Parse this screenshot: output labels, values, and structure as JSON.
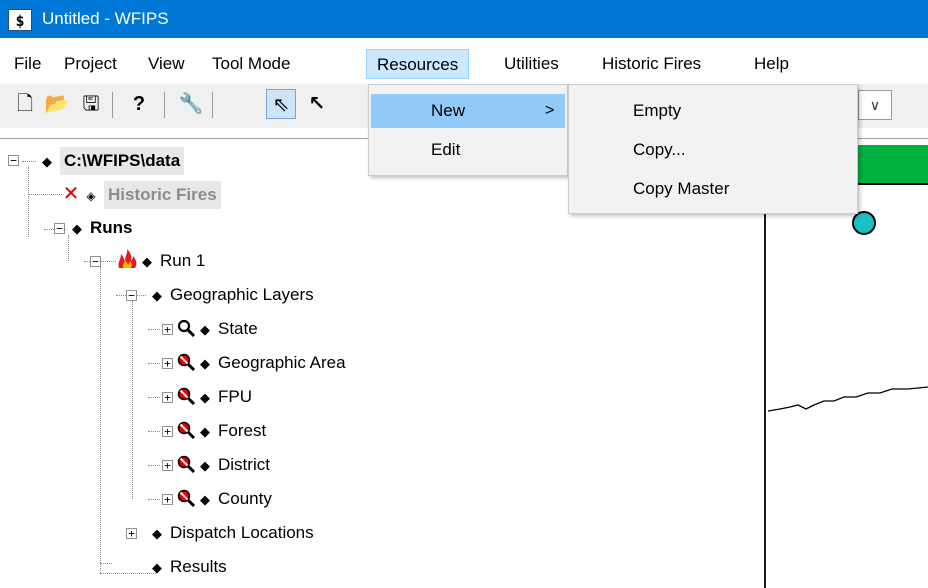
{
  "window": {
    "title": "Untitled - WFIPS",
    "app_icon_glyph": "$"
  },
  "menubar": {
    "items": [
      {
        "label": "File"
      },
      {
        "label": "Project"
      },
      {
        "label": "View"
      },
      {
        "label": "Tool Mode"
      },
      {
        "label": "Resources"
      },
      {
        "label": "Utilities"
      },
      {
        "label": "Historic Fires"
      },
      {
        "label": "Help"
      }
    ],
    "active": "Resources"
  },
  "toolbar": {
    "icons": [
      "new-file-icon",
      "open-folder-icon",
      "save-icon",
      "help-icon",
      "wrench-icon",
      "pointer-icon",
      "select-node-icon"
    ],
    "glyphs": {
      "new": "🗋",
      "open": "📂",
      "save": "🖫",
      "help": "?",
      "wrench": "🔧",
      "pointer": "⇖",
      "node": "↖",
      "combo_arrow": "∨"
    }
  },
  "resources_menu": {
    "items": [
      {
        "label": "New",
        "submenu_arrow": ">"
      },
      {
        "label": "Edit"
      }
    ]
  },
  "new_submenu": {
    "items": [
      {
        "label": "Empty"
      },
      {
        "label": "Copy..."
      },
      {
        "label": "Copy Master"
      }
    ]
  },
  "tree": {
    "root": "C:\\WFIPS\\data",
    "historic_fires": "Historic Fires",
    "runs": "Runs",
    "run1": "Run 1",
    "geographic_layers": "Geographic Layers",
    "layers": [
      "State",
      "Geographic Area",
      "FPU",
      "Forest",
      "District",
      "County"
    ],
    "dispatch_locations": "Dispatch Locations",
    "results": "Results",
    "expander_minus": "−",
    "expander_plus": "+",
    "bullet": "◆",
    "hollow_bullet": "◈",
    "x_mark": "✕"
  },
  "colors": {
    "titlebar": "#0078d7",
    "menu_highlight": "#cce8ff",
    "dropdown_highlight": "#91c9f7",
    "map_green": "#00b140",
    "map_dot": "#17c1c4"
  }
}
